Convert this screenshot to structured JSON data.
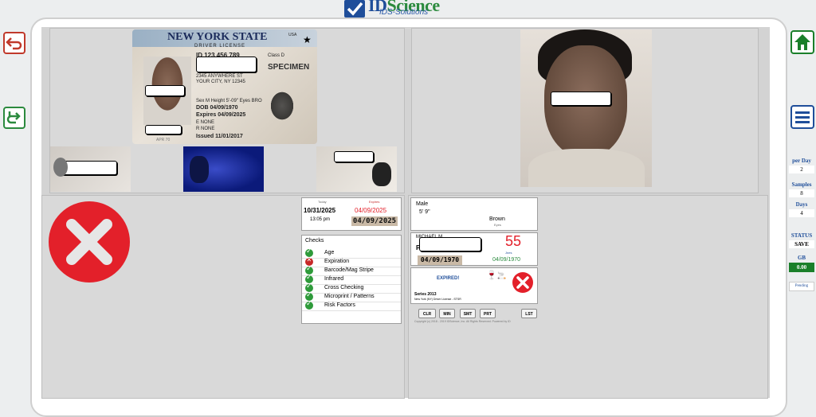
{
  "header": {
    "brand_left": "ID",
    "brand_right": "Science",
    "subtitle": "IDS-Solutions"
  },
  "nav": {
    "back_icon": "undo-arrow-icon",
    "forward_icon": "redo-arrow-icon",
    "home_icon": "home-icon",
    "menu_icon": "hamburger-menu-icon"
  },
  "license": {
    "state": "NEW YORK STATE",
    "usa": "USA",
    "doc_type": "DRIVER LICENSE",
    "id_no": "ID 123 456 789",
    "class_label": "Class D",
    "specimen": "SPECIMEN",
    "address1": "2345 ANYWHERE ST",
    "address2": "YOUR CITY, NY 12345",
    "sex_line": "Sex M  Height 5'-09\"  Eyes BRO",
    "dob": "DOB 04/09/1970",
    "expires": "Expires 04/09/2025",
    "endorse": "E NONE",
    "restrict": "R NONE",
    "issued": "Issued 11/01/2017",
    "under": "APR 70"
  },
  "status": {
    "today_label": "Today",
    "expires_label": "Expires",
    "today_date": "10/31/2025",
    "expires_date": "04/09/2025",
    "time": "13:05 pm",
    "barcode_exp": "04/09/2025"
  },
  "checks": {
    "title": "Checks",
    "items": [
      {
        "label": "Age",
        "ok": true
      },
      {
        "label": "Expiration",
        "ok": false
      },
      {
        "label": "Barcode/Mag Stripe",
        "ok": true
      },
      {
        "label": "Infrared",
        "ok": true
      },
      {
        "label": "Cross Checking",
        "ok": true
      },
      {
        "label": "Microprint / Patterns",
        "ok": true
      },
      {
        "label": "Risk Factors",
        "ok": true
      }
    ]
  },
  "person": {
    "sex": "Male",
    "height": "5' 9\"",
    "eyes_value": "Brown",
    "eyes_label": "Eyes",
    "name_prefix": "MICHAEL M",
    "name_initial": "P",
    "dob_box": "04/09/1970",
    "age": "55",
    "age_label": "Jnes",
    "dob_green": "04/09/1970",
    "expired": "EXPIRED!",
    "series": "Series 2013",
    "series_desc": "New York (NY) Driver License - STSR",
    "copyright": "Copyright (c) 2018 - 2019  IDScience, Inc.  All Rights Reserved. Powered by ID"
  },
  "buttons": [
    "CLR",
    "MIN",
    "SMT",
    "PRT",
    "LST"
  ],
  "stats": {
    "per_day_label": "per Day",
    "per_day": "2",
    "samples_label": "Samples",
    "samples": "8",
    "days_label": "Days",
    "days": "4",
    "status_label": "STATUS",
    "status_value": "SAVE",
    "gb_label": "GB",
    "gb_value": "0.00",
    "pending": "Pending"
  },
  "colors": {
    "accent_blue": "#1f4e9a",
    "alert_red": "#e3202a",
    "ok_green": "#2e9a3a",
    "gb_green": "#1a7f2a"
  }
}
